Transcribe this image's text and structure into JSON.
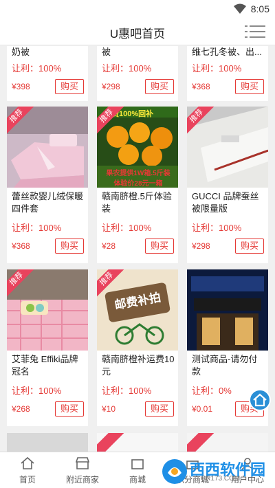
{
  "status": {
    "time": "8:05"
  },
  "header": {
    "title": "U惠吧首页"
  },
  "products": [
    {
      "name": "奶被",
      "profit": "让利：100%",
      "price": "¥398",
      "buy": "购买"
    },
    {
      "name": "被",
      "profit": "让利：100%",
      "price": "¥298",
      "buy": "购买"
    },
    {
      "name": "维七孔冬被、出...",
      "profit": "让利：100%",
      "price": "¥368",
      "buy": "购买"
    },
    {
      "tag": "推荐",
      "name": "蕾丝款婴儿绒保暖四件套",
      "profit": "让利：100%",
      "price": "¥368",
      "buy": "购买"
    },
    {
      "tag": "推荐",
      "name": "赣南脐橙.5斤体验装",
      "profit": "让利：100%",
      "price": "¥28",
      "buy": "购买",
      "img_text_1": "邮费100%回补",
      "img_text_2": "果农提供1W箱.5斤装",
      "img_text_3": "体验价28元一箱"
    },
    {
      "tag": "推荐",
      "name": "GUCCI 品牌蚕丝被限量版",
      "profit": "让利：100%",
      "price": "¥298",
      "buy": "购买"
    },
    {
      "tag": "推荐",
      "name": "艾菲兔 Effiki品牌冠名",
      "profit": "让利：100%",
      "price": "¥268",
      "buy": "购买"
    },
    {
      "tag": "推荐",
      "name": "赣南脐橙补运费10元",
      "profit": "让利：100%",
      "price": "¥10",
      "buy": "购买",
      "img_text_1": "邮费补拍"
    },
    {
      "name": "测试商品-请勿付款",
      "profit": "让利：0%",
      "price": "¥0.01",
      "buy": "购买"
    }
  ],
  "tabs": [
    {
      "label": "首页"
    },
    {
      "label": "附近商家"
    },
    {
      "label": "商城"
    },
    {
      "label": "积分商城"
    },
    {
      "label": "用户中心"
    }
  ],
  "watermark": {
    "text": "西西软件园",
    "url": "CR173.COM"
  }
}
